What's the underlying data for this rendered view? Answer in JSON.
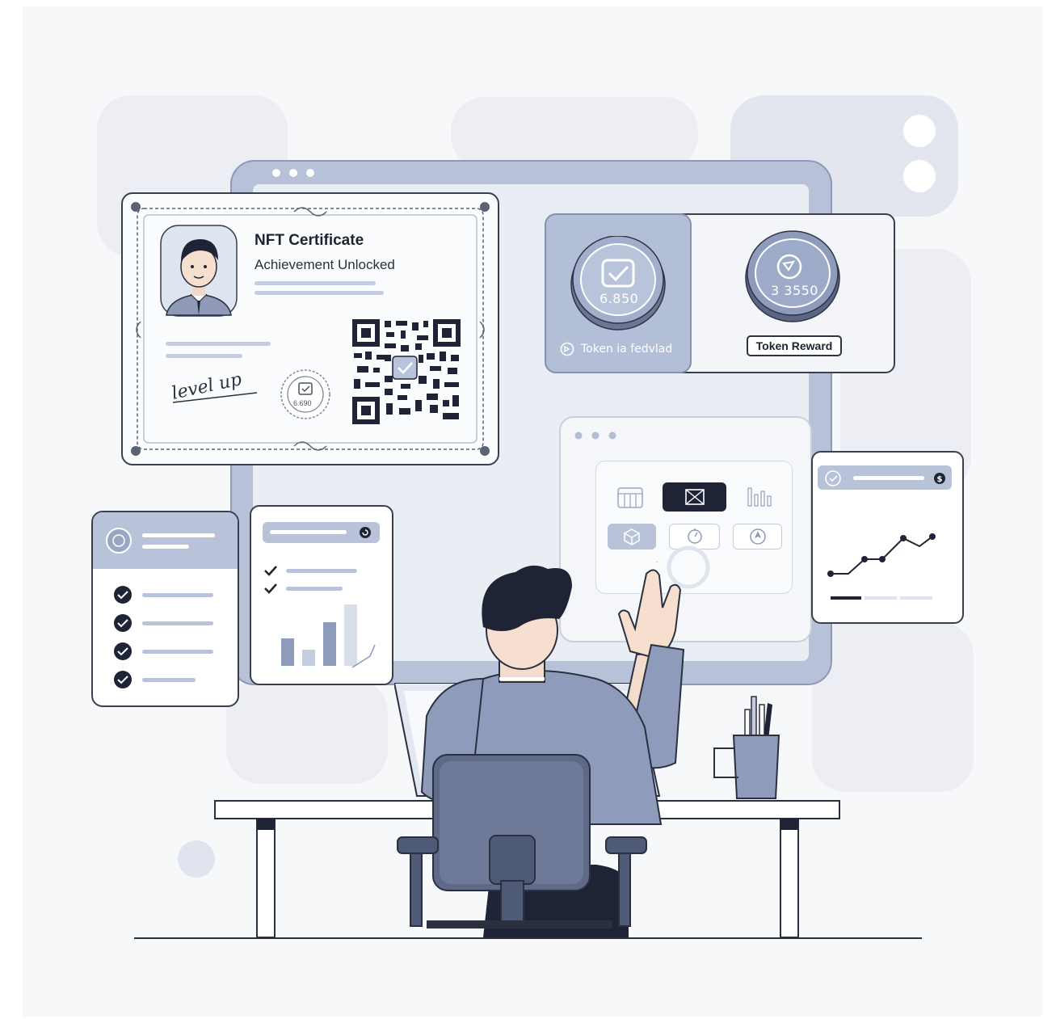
{
  "certificate": {
    "title": "NFT Certificate",
    "subtitle": "Achievement Unlocked",
    "signature": "level up",
    "seal_value": "6.690"
  },
  "tokens": {
    "coin_primary_value": "6.850",
    "coin_primary_caption": "Token ia fedvlad",
    "coin_secondary_value": "3 3550",
    "reward_badge": "Token Reward"
  },
  "colors": {
    "accent": "#8d9bbd",
    "dark": "#1e2436",
    "panel": "#b9c3da",
    "background": "#f7f8fa"
  },
  "icons": [
    "checkmark-icon",
    "qr-code-icon",
    "coin-icon",
    "dollar-icon",
    "calendar-icon",
    "bar-chart-icon",
    "cube-icon",
    "timer-icon",
    "compass-icon",
    "pen-icon"
  ]
}
